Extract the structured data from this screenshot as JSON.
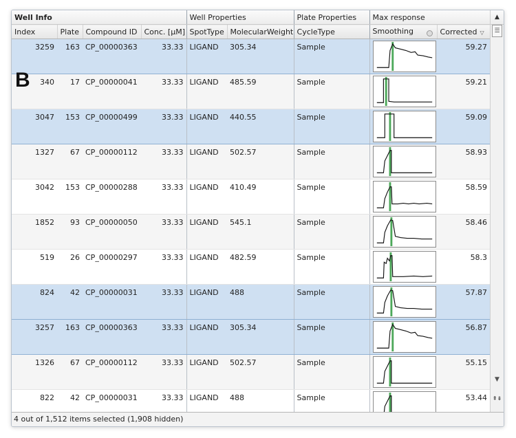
{
  "panel_label": "B",
  "group_headers": {
    "well_info": "Well Info",
    "well_properties": "Well Properties",
    "plate_properties": "Plate Properties",
    "max_response": "Max response"
  },
  "columns": {
    "index": "Index",
    "plate": "Plate",
    "compound_id": "Compound ID",
    "conc": "Conc. [µM]",
    "spot_type": "SpotType",
    "molecular_weight": "MolecularWeight",
    "cycle_type": "CycleType",
    "smoothing": "Smoothing",
    "corrected": "Corrected"
  },
  "sort_indicator": "▽",
  "rows": [
    {
      "index": "3259",
      "plate": "163",
      "compound_id": "CP_00000363",
      "conc": "33.33",
      "spot_type": "LIGAND",
      "molecular_weight": "305.34",
      "cycle_type": "Sample",
      "corrected": "59.27",
      "selected": true,
      "trace": "decay_slow"
    },
    {
      "index": "340",
      "plate": "17",
      "compound_id": "CP_00000041",
      "conc": "33.33",
      "spot_type": "LIGAND",
      "molecular_weight": "485.59",
      "cycle_type": "Sample",
      "corrected": "59.21",
      "selected": false,
      "trace": "square_fast"
    },
    {
      "index": "3047",
      "plate": "153",
      "compound_id": "CP_00000499",
      "conc": "33.33",
      "spot_type": "LIGAND",
      "molecular_weight": "440.55",
      "cycle_type": "Sample",
      "corrected": "59.09",
      "selected": true,
      "trace": "square_full"
    },
    {
      "index": "1327",
      "plate": "67",
      "compound_id": "CP_00000112",
      "conc": "33.33",
      "spot_type": "LIGAND",
      "molecular_weight": "502.57",
      "cycle_type": "Sample",
      "corrected": "58.93",
      "selected": false,
      "trace": "rise_drop"
    },
    {
      "index": "3042",
      "plate": "153",
      "compound_id": "CP_00000288",
      "conc": "33.33",
      "spot_type": "LIGAND",
      "molecular_weight": "410.49",
      "cycle_type": "Sample",
      "corrected": "58.59",
      "selected": false,
      "trace": "rise_drop_noisy"
    },
    {
      "index": "1852",
      "plate": "93",
      "compound_id": "CP_00000050",
      "conc": "33.33",
      "spot_type": "LIGAND",
      "molecular_weight": "545.1",
      "cycle_type": "Sample",
      "corrected": "58.46",
      "selected": false,
      "trace": "rise_decay"
    },
    {
      "index": "519",
      "plate": "26",
      "compound_id": "CP_00000297",
      "conc": "33.33",
      "spot_type": "LIGAND",
      "molecular_weight": "482.59",
      "cycle_type": "Sample",
      "corrected": "58.3",
      "selected": false,
      "trace": "jagged_drop"
    },
    {
      "index": "824",
      "plate": "42",
      "compound_id": "CP_00000031",
      "conc": "33.33",
      "spot_type": "LIGAND",
      "molecular_weight": "488",
      "cycle_type": "Sample",
      "corrected": "57.87",
      "selected": true,
      "trace": "rise_decay"
    },
    {
      "index": "3257",
      "plate": "163",
      "compound_id": "CP_00000363",
      "conc": "33.33",
      "spot_type": "LIGAND",
      "molecular_weight": "305.34",
      "cycle_type": "Sample",
      "corrected": "56.87",
      "selected": true,
      "trace": "decay_slow"
    },
    {
      "index": "1326",
      "plate": "67",
      "compound_id": "CP_00000112",
      "conc": "33.33",
      "spot_type": "LIGAND",
      "molecular_weight": "502.57",
      "cycle_type": "Sample",
      "corrected": "55.15",
      "selected": false,
      "trace": "rise_drop"
    },
    {
      "index": "822",
      "plate": "42",
      "compound_id": "CP_00000031",
      "conc": "33.33",
      "spot_type": "LIGAND",
      "molecular_weight": "488",
      "cycle_type": "Sample",
      "corrected": "53.44",
      "selected": false,
      "trace": "rise_drop"
    }
  ],
  "status": "4 out of 1,512 items selected (1,908 hidden)",
  "colors": {
    "selected_row": "#cfe0f2",
    "trace_line": "#111111",
    "marker_line": "#2e9a3e"
  },
  "icons": {
    "scroll_up": "▲",
    "column_menu": "☰",
    "scroll_down": "▼",
    "jump": "⇞⇟"
  }
}
